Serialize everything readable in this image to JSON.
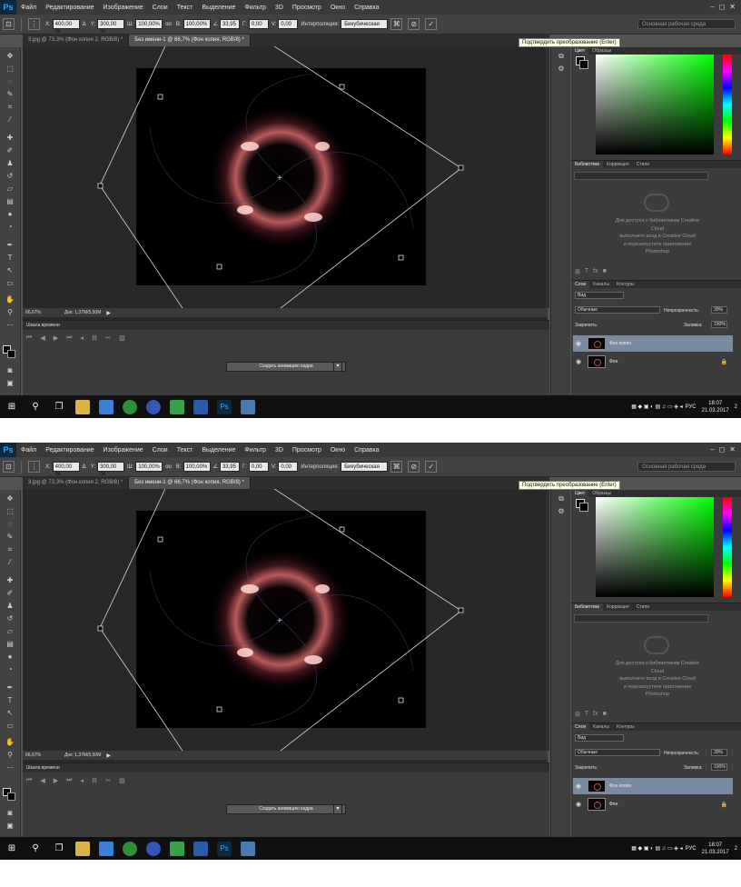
{
  "app": {
    "logo": "Ps"
  },
  "menu": [
    "Файл",
    "Редактирование",
    "Изображение",
    "Слои",
    "Текст",
    "Выделение",
    "Фильтр",
    "3D",
    "Просмотр",
    "Окно",
    "Справка"
  ],
  "window_controls": [
    "–",
    "◻",
    "✕"
  ],
  "options": {
    "x_label": "X:",
    "x_value": "400,00 пк",
    "y_label": "Y:",
    "y_value": "300,00 пк",
    "w_label": "Ш:",
    "w_value": "100,00%",
    "link_label": "оо",
    "h_label": "В:",
    "h_value": "100,00%",
    "angle_value": "33,95",
    "hskew_label": "Г:",
    "hskew_value": "0,00",
    "vskew_label": "V:",
    "vskew_value": "0,00",
    "interp_label": "Интерполяция:",
    "interp_value": "Бикубическая",
    "workspace": "Основная рабочая среда",
    "tooltip": "Подтвердить преобразование (Enter)"
  },
  "tabs": [
    "3.jpg @ 73,3% (Фон копия 2, RGB/8) *",
    "Без имени-1 @ 66,7% (Фон копия, RGB/8) *"
  ],
  "status": {
    "zoom": "66,67%",
    "doc": "Док: 1,37M/5,50M"
  },
  "timeline": {
    "title": "Шкала времени",
    "create_button": "Создать анимацию кадра"
  },
  "color_panel": {
    "tabs": [
      "Цвет",
      "Образцы"
    ]
  },
  "libraries": {
    "tabs": [
      "Библиотеки",
      "Коррекция",
      "Стили"
    ],
    "message_lines": [
      "Для доступа к библиотекам Creative",
      "Cloud",
      "выполните вход в Creative Cloud",
      "и перезапустите приложение",
      "Photoshop"
    ]
  },
  "layers_panel": {
    "tabs": [
      "Слои",
      "Каналы",
      "Контуры"
    ],
    "kind": "Вид",
    "blend": "Обычные",
    "opacity_label": "Непрозрачность:",
    "opacity": "30%",
    "lock_label": "Закрепить:",
    "fill_label": "Заливка:",
    "fill": "100%",
    "layers": [
      "Фон копия",
      "Фон"
    ]
  },
  "taskbar": {
    "lang": "РУС",
    "time": "18:07",
    "date": "21.03.2017",
    "notif": "2"
  },
  "colors": {
    "accent": "#31a8ff",
    "selected_layer": "#7a8aa0"
  }
}
